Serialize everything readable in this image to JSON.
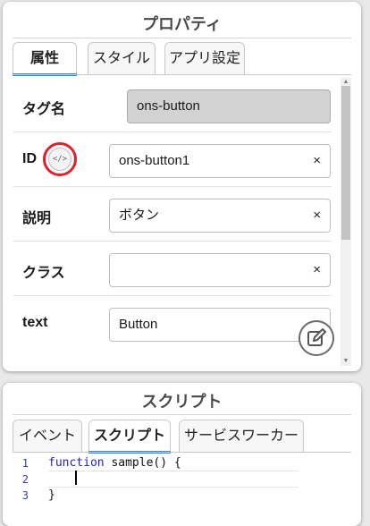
{
  "properties_panel": {
    "title": "プロパティ",
    "tabs": [
      {
        "label": "属性",
        "active": true
      },
      {
        "label": "スタイル",
        "active": false
      },
      {
        "label": "アプリ設定",
        "active": false
      }
    ],
    "rows": [
      {
        "label": "タグ名",
        "value": "ons-button",
        "readonly": true
      },
      {
        "label": "ID",
        "value": "ons-button1",
        "clear": "×",
        "code_toggle": "</>"
      },
      {
        "label": "説明",
        "value": "ボタン",
        "clear": "×"
      },
      {
        "label": "クラス",
        "value": "",
        "clear": "×"
      },
      {
        "label": "text",
        "value": "Button"
      }
    ],
    "edit_icon": "edit-pencil-icon",
    "highlight_color": "#e0202a"
  },
  "script_panel": {
    "title": "スクリプト",
    "tabs": [
      {
        "label": "イベント",
        "active": false
      },
      {
        "label": "スクリプト",
        "active": true
      },
      {
        "label": "サービスワーカー",
        "active": false
      }
    ],
    "editor": {
      "line_numbers": [
        "1",
        "2",
        "3"
      ],
      "lines": [
        {
          "keyword": "function",
          "rest": " sample() {"
        },
        {
          "keyword": "",
          "rest": ""
        },
        {
          "keyword": "",
          "rest": "}"
        }
      ]
    }
  },
  "colors": {
    "accent_tab_underline": "#2b8fd6",
    "readonly_field": "#d2d2d2",
    "keyword": "#2020d0"
  }
}
